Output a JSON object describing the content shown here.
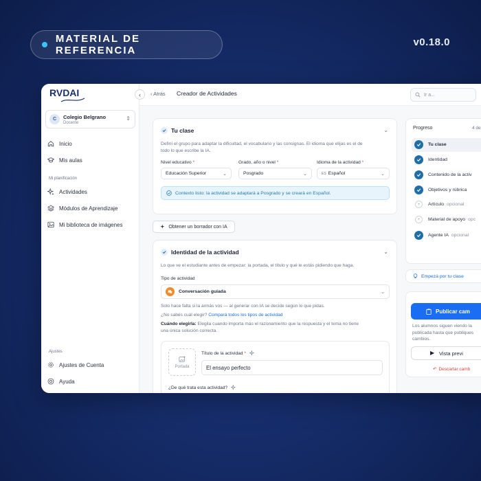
{
  "badge": {
    "label": "MATERIAL DE REFERENCIA"
  },
  "version": "v0.18.0",
  "brand": {
    "logo_text": "RVDAI"
  },
  "sidebar": {
    "org_name": "Colegio Belgrano",
    "org_initial": "C",
    "org_role": "Docente",
    "items": [
      {
        "label": "Inicio",
        "icon": "home-icon"
      },
      {
        "label": "Mis aulas",
        "icon": "graduation-cap-icon"
      }
    ],
    "section_planning": "Mi planificación",
    "planning_items": [
      {
        "label": "Actividades",
        "icon": "sparkles-icon"
      },
      {
        "label": "Módulos de Aprendizaje",
        "icon": "layers-icon"
      },
      {
        "label": "Mi biblioteca de imágenes",
        "icon": "image-icon"
      }
    ],
    "section_settings": "Ajustes",
    "settings_items": [
      {
        "label": "Ajustes de Cuenta",
        "icon": "gear-icon"
      },
      {
        "label": "Ayuda",
        "icon": "lifebuoy-icon"
      }
    ]
  },
  "topbar": {
    "back_label": "Atrás",
    "title": "Creador de Actividades",
    "search_placeholder": "Ir a..."
  },
  "class_card": {
    "title": "Tu clase",
    "description_line1": "Definí el grupo para adaptar la dificultad, el vocabulario y las consignas. El idioma que elijas es el de",
    "description_line2": "todo lo que escribe la IA.",
    "level_label": "Nivel educativo",
    "level_value": "Educación Superior",
    "grade_label": "Grado, año o nivel",
    "grade_value": "Posgrado",
    "language_label": "Idioma de la actividad",
    "language_value": "Español",
    "language_prefix": "ES",
    "required_mark": "*",
    "context_message": "Contexto listo: la actividad se adaptará a Posgrado y se creará en Español."
  },
  "draft_button": "Obtener un borrador con IA",
  "identity_card": {
    "title": "Identidad de la actividad",
    "description": "Lo que ve el estudiante antes de empezar: la portada, el título y qué le estás pidiendo que haga.",
    "type_label": "Tipo de actividad",
    "type_value": "Conversación guiada",
    "hint": "Solo hace falta si la armás vos — al generar con IA se decide según lo que pidas.",
    "compare_question": "¿No sabés cuál elegir?",
    "compare_link": "Compará todos los tipos de actividad",
    "when_label": "Cuándo elegirla:",
    "when_text_line1": "Elegila cuando importa más el razonamiento que la respuesta y el tema no tiene",
    "when_text_line2": "una única solución correcta.",
    "cover_label": "Portada",
    "activity_title_label": "Título de la actividad",
    "activity_title_value": "El ensayo perfecto",
    "about_label": "¿De qué trata esta actividad?"
  },
  "progress": {
    "title": "Progreso",
    "counter": "4 de",
    "steps": [
      {
        "label": "Tu clase",
        "done": true,
        "optional": ""
      },
      {
        "label": "Identidad",
        "done": true,
        "optional": ""
      },
      {
        "label": "Contenido de la activ",
        "done": true,
        "optional": ""
      },
      {
        "label": "Objetivos y rúbrica",
        "done": true,
        "optional": ""
      },
      {
        "label": "Artículo",
        "done": false,
        "optional": "opcional"
      },
      {
        "label": "Material de apoyo",
        "done": false,
        "optional": "opc"
      },
      {
        "label": "Agente IA",
        "done": true,
        "optional": "opcional"
      }
    ],
    "start_link": "Empezá por tu clase"
  },
  "publish": {
    "button": "Publicar cam",
    "note_line1": "Los alumnos siguen viendo la",
    "note_line2": "publicada hasta que publiques",
    "note_line3": "cambios.",
    "preview_button": "Vista previ",
    "discard_link": "Descartar camb"
  },
  "colors": {
    "accent": "#1b6ef3",
    "step_done": "#1f6ea8",
    "page_bg": "#1a3176"
  }
}
